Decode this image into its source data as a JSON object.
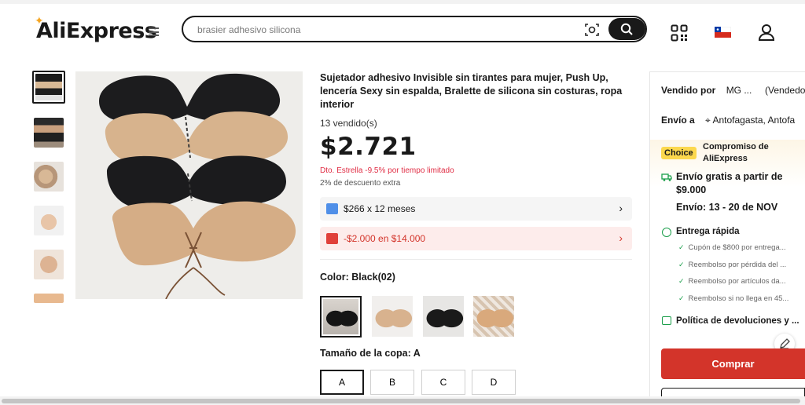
{
  "header": {
    "logo": "AliExpress",
    "search_value": "brasier adhesivo silicona",
    "search_placeholder": "brasier adhesivo silicona"
  },
  "gallery": {
    "thumbnail_count": 6,
    "active_index": 0
  },
  "product": {
    "title": "Sujetador adhesivo Invisible sin tirantes para mujer, Push Up, lencería Sexy sin espalda, Bralette de silicona sin costuras, ropa interior",
    "sold": "13 vendido(s)",
    "price": "$2.721",
    "promo": "Dto. Estrella -9.5% por tiempo limitado",
    "extra_discount": "2% de descuento extra",
    "installments": "$266 x 12 meses",
    "coupon": "-$2.000 en $14.000",
    "color_label": "Color: Black(02)",
    "color_options": [
      "Black(02)",
      "Nude",
      "Black",
      "Nude pattern"
    ],
    "size_label": "Tamaño de la copa: A",
    "sizes": [
      "A",
      "B",
      "C",
      "D"
    ],
    "selected_size": "A"
  },
  "seller": {
    "sold_by_label": "Vendido por",
    "sold_by_value": "MG ...",
    "sold_by_suffix": "(Vendedor",
    "ship_to_label": "Envío a",
    "ship_to_value": "Antofagasta, Antofa",
    "choice_badge": "Choice",
    "choice_title": "Compromiso de AliExpress",
    "free_shipping": "Envío gratis a partir de $9.000",
    "delivery": "Envío: 13 - 20 de NOV",
    "fast_delivery": "Entrega rápida",
    "benefits": [
      "Cupón de $800 por entrega...",
      "Reembolso por pérdida del ...",
      "Reembolso por artículos da...",
      "Reembolso si no llega en 45..."
    ],
    "returns": "Política de devoluciones y ...",
    "buy_button": "Comprar"
  },
  "colors": {
    "accent_red": "#d3342a",
    "promo_red": "#e02d44",
    "green": "#1a9e4a",
    "choice_yellow": "#fcd84d"
  }
}
